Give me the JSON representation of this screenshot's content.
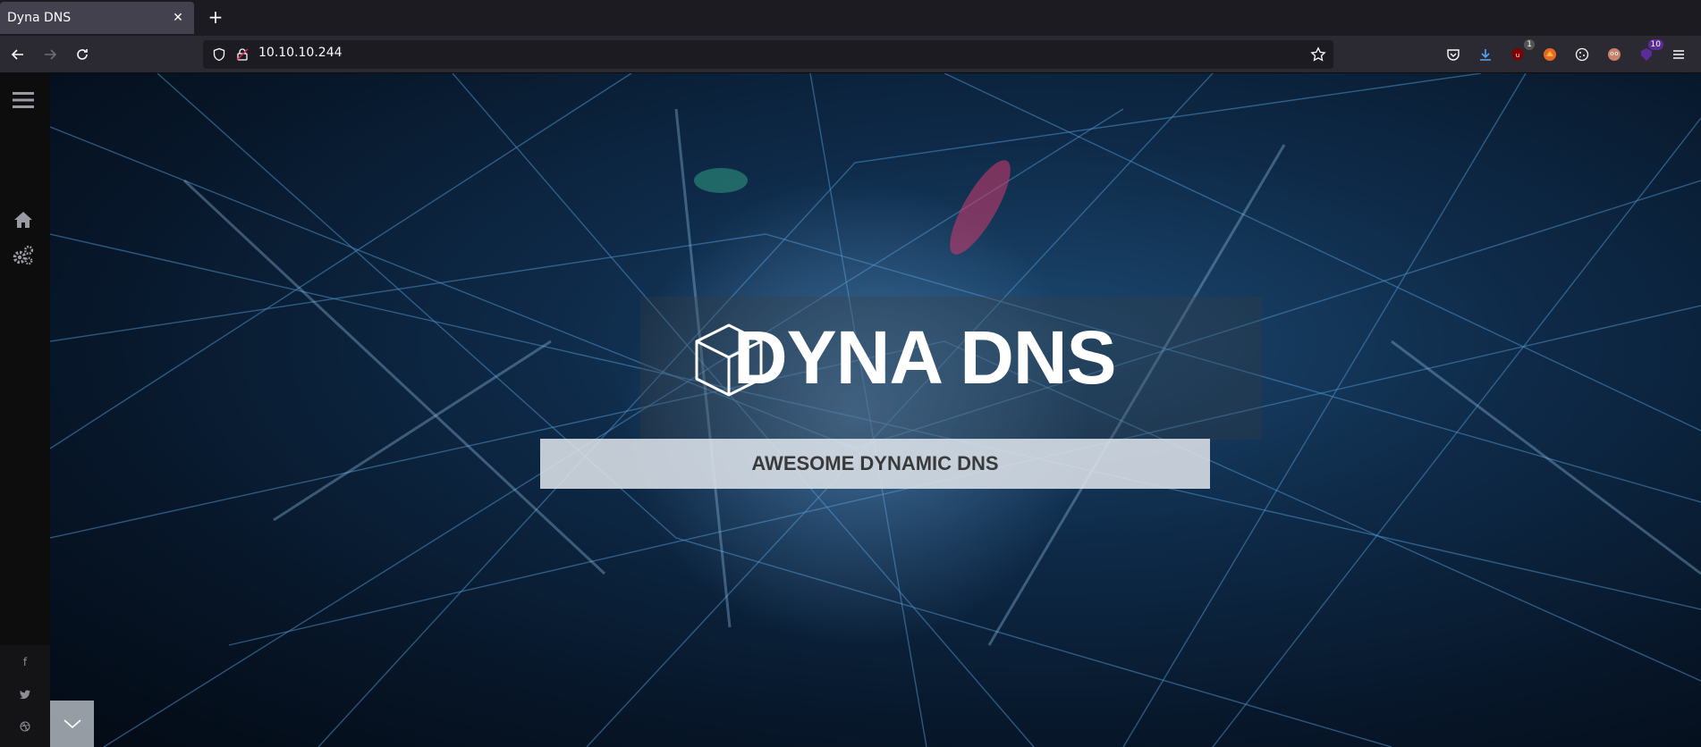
{
  "browser": {
    "tab": {
      "title": "Dyna DNS"
    },
    "address": "10.10.10.244",
    "extensions": [
      {
        "name": "pocket-icon"
      },
      {
        "name": "downloads-icon"
      },
      {
        "name": "ublock-icon",
        "badge": "1"
      },
      {
        "name": "foxyproxy-icon"
      },
      {
        "name": "cookie-icon"
      },
      {
        "name": "profile-icon"
      },
      {
        "name": "extension-purple-icon",
        "badge": "10"
      }
    ]
  },
  "sidebar": {
    "items": [
      {
        "name": "menu-icon"
      },
      {
        "name": "home-icon"
      },
      {
        "name": "settings-icon"
      }
    ],
    "social": [
      "f",
      "t",
      "d"
    ]
  },
  "hero": {
    "title": "DYNA DNS",
    "subtitle": "AWESOME DYNAMIC DNS"
  },
  "colors": {
    "chrome_dark": "#1c1b22",
    "navbar": "#2b2a33",
    "accent_purple": "#5b2b99",
    "hero_blue": "#1c4870"
  }
}
